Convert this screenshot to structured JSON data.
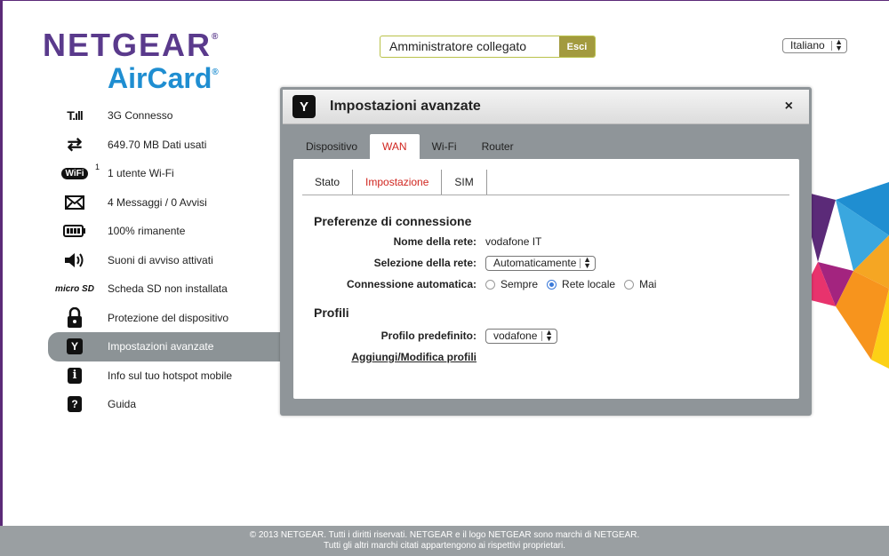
{
  "brand": {
    "netgear": "NETGEAR",
    "aircard": "AirCard",
    "reg": "®"
  },
  "header": {
    "login_status": "Amministratore collegato",
    "logout_label": "Esci",
    "language": "Italiano"
  },
  "sidebar": {
    "items": [
      {
        "label": "3G Connesso",
        "icon": "signal-icon"
      },
      {
        "label": "649.70 MB Dati usati",
        "icon": "data-transfer-icon"
      },
      {
        "label": "1 utente Wi-Fi",
        "icon": "wifi-icon",
        "badge": "1"
      },
      {
        "label": "4 Messaggi / 0 Avvisi",
        "icon": "envelope-icon"
      },
      {
        "label": "100% rimanente",
        "icon": "battery-icon"
      },
      {
        "label": "Suoni di avviso attivati",
        "icon": "speaker-icon"
      },
      {
        "label": "Scheda SD non installata",
        "icon": "microsd-icon"
      },
      {
        "label": "Protezione del dispositivo",
        "icon": "lock-icon"
      },
      {
        "label": "Impostazioni avanzate",
        "icon": "wrench-icon",
        "active": true
      },
      {
        "label": "Info sul tuo hotspot mobile",
        "icon": "info-icon"
      },
      {
        "label": "Guida",
        "icon": "help-icon"
      }
    ],
    "icon_glyphs": {
      "signal": "T.ıll",
      "wifi": "WiFi",
      "microsd": "micro SD"
    }
  },
  "panel": {
    "title": "Impostazioni avanzate",
    "close": "×",
    "tabs": [
      "Dispositivo",
      "WAN",
      "Wi-Fi",
      "Router"
    ],
    "active_tab": "WAN",
    "subtabs": [
      "Stato",
      "Impostazione",
      "SIM"
    ],
    "active_subtab": "Impostazione",
    "connection_prefs": {
      "heading": "Preferenze di connessione",
      "network_name_label": "Nome della rete:",
      "network_name_value": "vodafone IT",
      "network_selection_label": "Selezione della rete:",
      "network_selection_value": "Automaticamente",
      "auto_connect_label": "Connessione automatica:",
      "auto_connect_options": [
        "Sempre",
        "Rete locale",
        "Mai"
      ],
      "auto_connect_selected": "Rete locale"
    },
    "profiles": {
      "heading": "Profili",
      "default_profile_label": "Profilo predefinito:",
      "default_profile_value": "vodafone",
      "edit_link": "Aggiungi/Modifica profili"
    }
  },
  "footer": {
    "line1": "© 2013 NETGEAR. Tutti i diritti riservati. NETGEAR e il logo NETGEAR sono marchi di NETGEAR.",
    "line2": "Tutti gli altri marchi citati appartengono ai rispettivi proprietari."
  },
  "colors": {
    "brand_purple": "#5a3a8c",
    "aircard_blue": "#1f8ed1",
    "active_red": "#d0251f",
    "panel_gray": "#8f9599",
    "logout_olive": "#a29a3e"
  }
}
